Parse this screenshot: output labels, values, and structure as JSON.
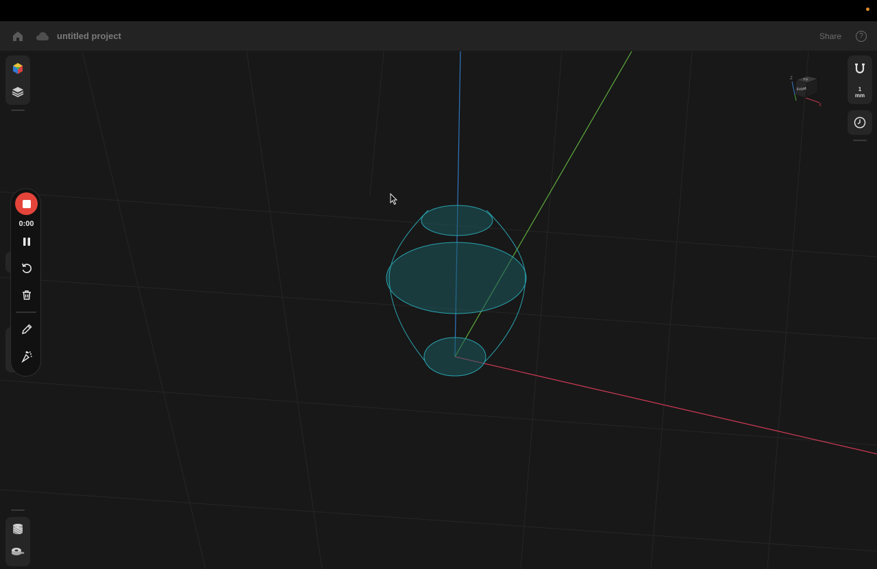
{
  "project": {
    "title": "untitled project",
    "share_label": "Share",
    "help_label": "?"
  },
  "recorder": {
    "time": "0:00"
  },
  "right_toolbar": {
    "grid_value": "1",
    "grid_unit": "mm"
  },
  "viewcube": {
    "face_label": "Front",
    "top_label": "Top",
    "axis_z": "Z",
    "axis_x": "X",
    "axis_y": "Y"
  },
  "icons": {
    "home": "home-icon",
    "cloud": "cloud-icon",
    "shapes": "shapes-icon",
    "layers": "layers-icon",
    "stop": "stop-icon",
    "pause": "pause-icon",
    "undo": "undo-icon",
    "delete": "trash-icon",
    "pen": "pen-icon",
    "magic": "magic-icon",
    "transform": "transform-icon",
    "tools": "tools-icon",
    "texture": "texture-icon",
    "tape": "tape-icon",
    "magnet": "magnet-icon",
    "history": "clock-icon"
  },
  "colors": {
    "record": "#e5443a",
    "axis_x": "#d23a57",
    "axis_y": "#5fae3d",
    "axis_z": "#2f78c4",
    "wire": "#2aa4b0",
    "fill": "#1c5a5e"
  }
}
